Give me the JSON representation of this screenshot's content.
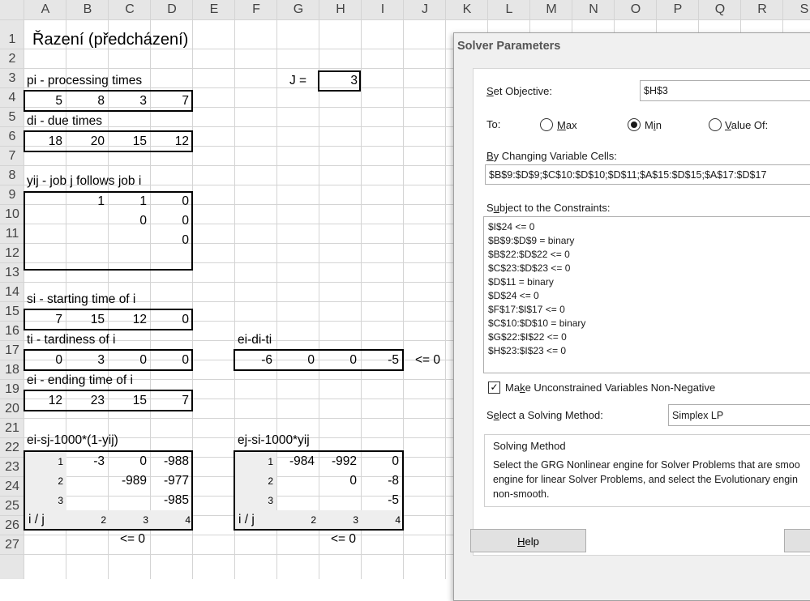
{
  "sheet": {
    "columns": [
      "A",
      "B",
      "C",
      "D",
      "E",
      "F",
      "G",
      "H",
      "I",
      "J",
      "K",
      "L",
      "M",
      "N",
      "O",
      "P",
      "Q",
      "R",
      "S"
    ],
    "rows": [
      "1",
      "2",
      "3",
      "4",
      "5",
      "6",
      "7",
      "8",
      "9",
      "10",
      "11",
      "12",
      "13",
      "14",
      "15",
      "16",
      "17",
      "18",
      "19",
      "20",
      "21",
      "22",
      "23",
      "24",
      "25",
      "26",
      "27"
    ],
    "title": "Řazení (předcházení)",
    "p_label": "pi  - processing times",
    "j_label": "J =",
    "j_value": "3",
    "p_values": [
      "5",
      "8",
      "3",
      "7"
    ],
    "d_label": "di  - due times",
    "d_values": [
      "18",
      "20",
      "15",
      "12"
    ],
    "y_label": "yij  - job j follows job i",
    "y9": [
      "1",
      "1",
      "0"
    ],
    "y10": [
      "0",
      "0"
    ],
    "y11": [
      "0"
    ],
    "s_label": "si  - starting time of i",
    "s_values": [
      "7",
      "15",
      "12",
      "0"
    ],
    "t_label": "ti  - tardiness of i",
    "t_values": [
      "0",
      "3",
      "0",
      "0"
    ],
    "edt_label": "ei-di-ti",
    "edt_values": [
      "-6",
      "0",
      "0",
      "-5"
    ],
    "edt_constraint": "<= 0",
    "e_label": "ei  - ending time of i",
    "e_values": [
      "12",
      "23",
      "15",
      "7"
    ],
    "left_matrix": {
      "label": "ei-sj-1000*(1-yij)",
      "row_idx": [
        "1",
        "2",
        "3"
      ],
      "r22": [
        "-3",
        "0",
        "-988"
      ],
      "r23": [
        "-989",
        "-977"
      ],
      "r24": [
        "-985"
      ],
      "corner": "i / j",
      "col_idx": [
        "2",
        "3",
        "4"
      ],
      "constraint": "<= 0"
    },
    "right_matrix": {
      "label": "ej-si-1000*yij",
      "row_idx": [
        "1",
        "2",
        "3"
      ],
      "r22": [
        "-984",
        "-992",
        "0"
      ],
      "r23": [
        "0",
        "-8"
      ],
      "r24": [
        "-5"
      ],
      "corner": "i / j",
      "col_idx": [
        "2",
        "3",
        "4"
      ],
      "constraint": "<= 0"
    }
  },
  "dialog": {
    "title": "Solver Parameters",
    "set_objective_label": "Set Objective:",
    "objective_value": "$H$3",
    "to_label": "To:",
    "max_label": "Max",
    "min_label": "Min",
    "value_of_label": "Value Of:",
    "selected_goal": "Min",
    "changing_label": "By Changing Variable Cells:",
    "changing_value": "$B$9:$D$9;$C$10:$D$10;$D$11;$A$15:$D$15;$A$17:$D$17",
    "constraints_label": "Subject to the Constraints:",
    "constraints": [
      "$I$24 <= 0",
      "$B$9:$D$9 = binary",
      "$B$22:$D$22 <= 0",
      "$C$23:$D$23 <= 0",
      "$D$11 = binary",
      "$D$24 <= 0",
      "$F$17:$I$17 <= 0",
      "$C$10:$D$10 = binary",
      "$G$22:$I$22 <= 0",
      "$H$23:$I$23 <= 0"
    ],
    "nonneg_label": "Make Unconstrained Variables Non-Negative",
    "nonneg_checked": true,
    "method_label": "Select a Solving Method:",
    "method_value": "Simplex LP",
    "solving_method_title": "Solving Method",
    "solving_method_text": [
      "Select the GRG Nonlinear engine for Solver Problems that are smoo",
      "engine for linear Solver Problems, and select the Evolutionary engin",
      "non-smooth."
    ],
    "help_button": "Help"
  }
}
